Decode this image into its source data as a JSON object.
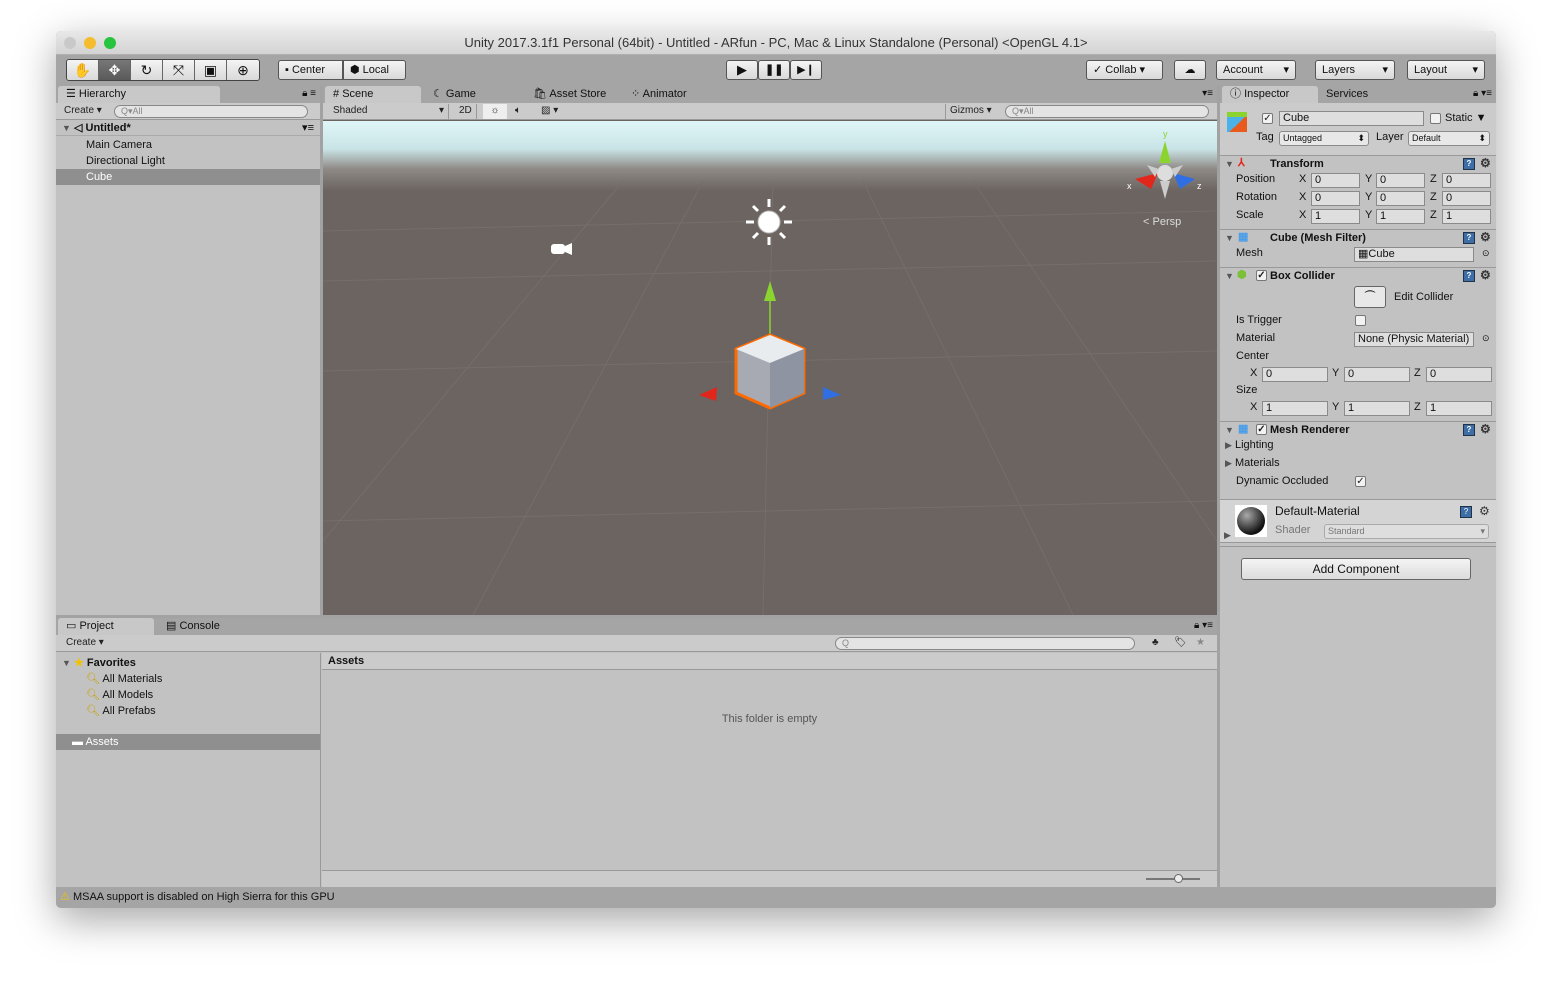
{
  "window": {
    "title": "Unity 2017.3.1f1 Personal (64bit) - Untitled - ARfun - PC, Mac & Linux Standalone (Personal) <OpenGL 4.1>"
  },
  "toolbar": {
    "tools": [
      "hand-icon",
      "move-icon",
      "rotate-icon",
      "scale-icon",
      "rect-icon",
      "transform-icon"
    ],
    "active_tool": "move",
    "pivot": "Center",
    "space": "Local",
    "collab": "Collab",
    "account": "Account",
    "layers": "Layers",
    "layout": "Layout"
  },
  "hierarchy": {
    "tab": "Hierarchy",
    "create": "Create",
    "search_placeholder": "All",
    "scene": "Untitled*",
    "items": [
      "Main Camera",
      "Directional Light",
      "Cube"
    ],
    "selected": "Cube"
  },
  "scene": {
    "tabs": [
      "Scene",
      "Game",
      "Asset Store",
      "Animator"
    ],
    "active_tab": "Scene",
    "shading": "Shaded",
    "mode_2d": "2D",
    "gizmos": "Gizmos",
    "search_placeholder": "All",
    "projection": "Persp",
    "axis_labels": {
      "x": "x",
      "y": "y",
      "z": "z"
    }
  },
  "inspector": {
    "tabs": [
      "Inspector",
      "Services"
    ],
    "object_name": "Cube",
    "active": true,
    "static_label": "Static",
    "tag_label": "Tag",
    "tag": "Untagged",
    "layer_label": "Layer",
    "layer": "Default",
    "transform": {
      "title": "Transform",
      "rows": [
        {
          "label": "Position",
          "x": "0",
          "y": "0",
          "z": "0"
        },
        {
          "label": "Rotation",
          "x": "0",
          "y": "0",
          "z": "0"
        },
        {
          "label": "Scale",
          "x": "1",
          "y": "1",
          "z": "1"
        }
      ]
    },
    "mesh_filter": {
      "title": "Cube (Mesh Filter)",
      "mesh_label": "Mesh",
      "mesh": "Cube"
    },
    "box_collider": {
      "title": "Box Collider",
      "edit_collider": "Edit Collider",
      "is_trigger_label": "Is Trigger",
      "is_trigger": false,
      "material_label": "Material",
      "material": "None (Physic Material)",
      "center_label": "Center",
      "center": {
        "x": "0",
        "y": "0",
        "z": "0"
      },
      "size_label": "Size",
      "size": {
        "x": "1",
        "y": "1",
        "z": "1"
      }
    },
    "mesh_renderer": {
      "title": "Mesh Renderer",
      "lighting": "Lighting",
      "materials": "Materials",
      "dynamic_occluded_label": "Dynamic Occluded",
      "dynamic_occluded": true
    },
    "material": {
      "name": "Default-Material",
      "shader_label": "Shader",
      "shader": "Standard"
    },
    "add_component": "Add Component"
  },
  "project": {
    "tabs": [
      "Project",
      "Console"
    ],
    "create": "Create",
    "favorites": "Favorites",
    "favorites_items": [
      "All Materials",
      "All Models",
      "All Prefabs"
    ],
    "assets": "Assets",
    "breadcrumb": "Assets",
    "empty": "This folder is empty"
  },
  "status": {
    "message": "MSAA support is disabled on High Sierra for this GPU"
  },
  "colors": {
    "selection": "#8f8f8f",
    "panel": "#c2c2c2",
    "scene_floor": "#6b6460",
    "sky": "#dff6f8",
    "warning": "#f2c200"
  }
}
